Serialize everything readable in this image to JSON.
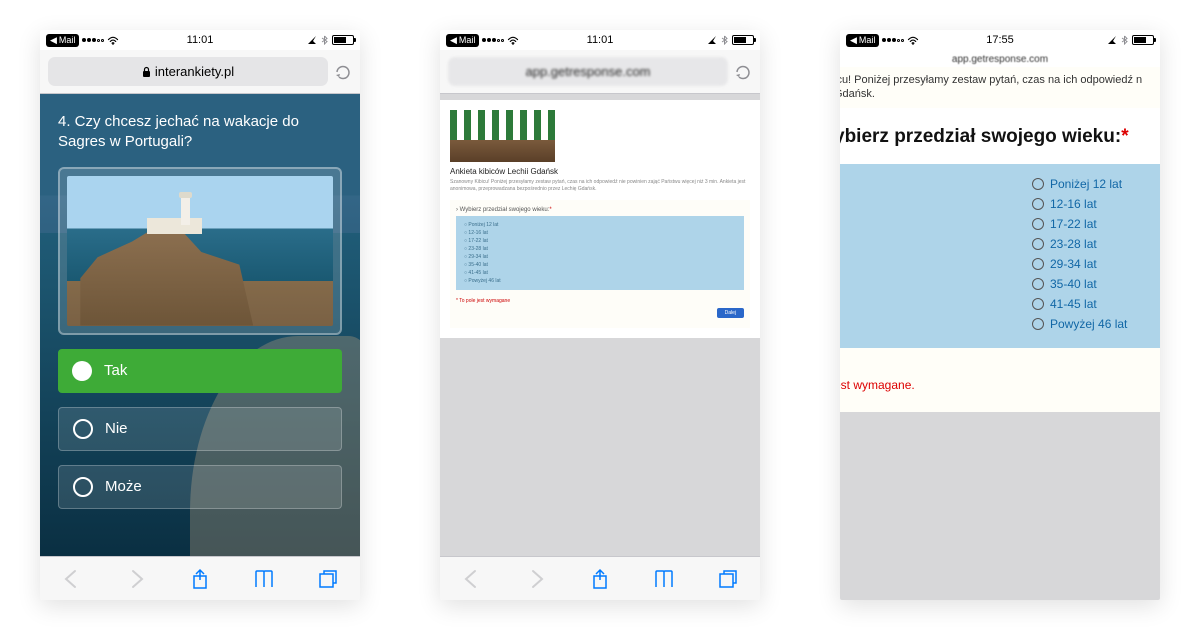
{
  "phones": [
    {
      "status": {
        "back": "Mail",
        "time": "11:01"
      },
      "url": "interankiety.pl",
      "question": "4. Czy chcesz jechać na wakacje do Sagres w Portugali?",
      "options": [
        {
          "label": "Tak",
          "selected": true
        },
        {
          "label": "Nie",
          "selected": false
        },
        {
          "label": "Może",
          "selected": false
        }
      ]
    },
    {
      "status": {
        "back": "Mail",
        "time": "11:01"
      },
      "url": "app.getresponse.com",
      "form_title": "Ankieta kibiców Lechii Gdańsk",
      "form_sub": "Szanowny Kibicu! Poniżej przesyłamy zestaw pytań, czas na ich odpowiedź nie powinien zająć Państwu więcej niż 3 min. Ankieta jest anonimowa, przeprowadzana bezpośrednio przez Lechię Gdańsk.",
      "question_label": "Wybierz przedział swojego wieku:",
      "options": [
        "Poniżej 12 lat",
        "12-16 lat",
        "17-22 lat",
        "23-28 lat",
        "29-34 lat",
        "35-40 lat",
        "41-45 lat",
        "Powyżej 46 lat"
      ],
      "required_msg": "* To pole jest wymagane",
      "next_label": "Dalej"
    },
    {
      "status": {
        "back": "Mail",
        "time": "17:55"
      },
      "url": "app.getresponse.com",
      "intro_fragment": "icu! Poniżej przesyłamy zestaw pytań, czas na ich odpowiedź n",
      "intro_fragment2": "Gdańsk.",
      "heading_fragment": "ybierz przedział swojego wieku:",
      "options": [
        "Poniżej 12 lat",
        "12-16 lat",
        "17-22 lat",
        "23-28 lat",
        "29-34 lat",
        "35-40 lat",
        "41-45 lat",
        "Powyżej 46 lat"
      ],
      "required_fragment": "est wymagane."
    }
  ]
}
